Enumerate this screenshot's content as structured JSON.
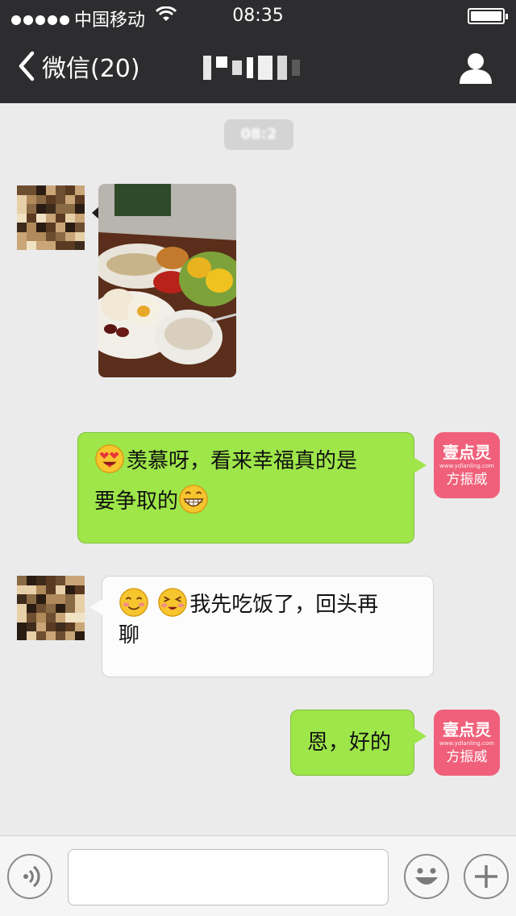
{
  "status_bar": {
    "carrier": "中国移动",
    "time": "08:35"
  },
  "nav": {
    "back_label": "微信(20)",
    "title": "",
    "profile_icon": "person-icon"
  },
  "chat": {
    "time_badge": "08:2",
    "messages": [
      {
        "from": "other",
        "type": "image",
        "description": ""
      },
      {
        "from": "self",
        "type": "text",
        "emoji_start": "heart-eyes-emoji",
        "text_a": "羡慕呀，看来幸福真的是",
        "text_b": "要争取的",
        "emoji_end": "grin-emoji"
      },
      {
        "from": "other",
        "type": "text",
        "emoji_1": "blush-emoji",
        "emoji_2": "excited-emoji",
        "text_a": "我先吃饭了，回头再",
        "text_b": "聊"
      },
      {
        "from": "self",
        "type": "text",
        "text": "恩，好的"
      }
    ],
    "self_avatar": {
      "line1": "壹点灵",
      "line2": "www.ydlanling.com",
      "line3": "方振威"
    }
  },
  "input_bar": {
    "voice_icon": "voice-icon",
    "emoji_icon": "smiley-icon",
    "plus_icon": "plus-icon",
    "placeholder": ""
  },
  "colors": {
    "header_bg": "#2d2d2f",
    "chat_bg": "#ebebeb",
    "self_bubble": "#9ee649",
    "other_bubble": "#fcfcfc",
    "avatar_pink": "#f0607a"
  }
}
